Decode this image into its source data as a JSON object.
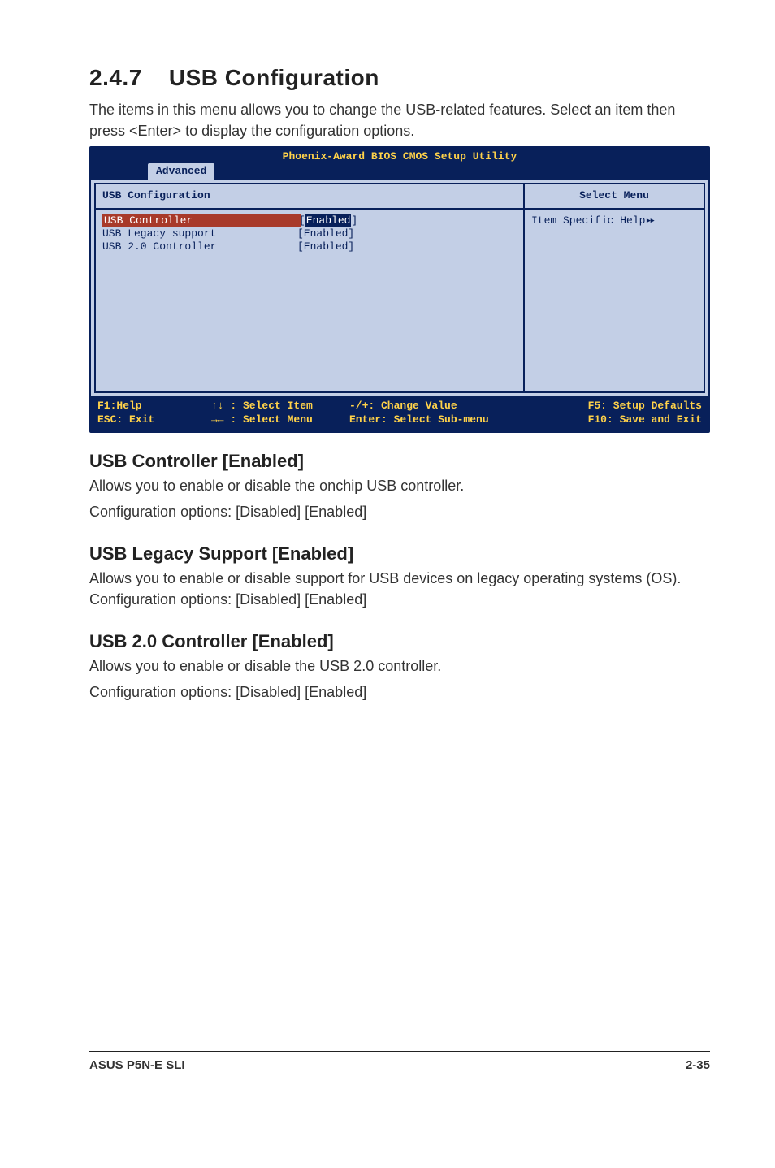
{
  "section": {
    "number": "2.4.7",
    "title": "USB Configuration",
    "intro": "The items in this menu allows you to change the USB-related features. Select an item then press <Enter> to display the configuration options."
  },
  "bios": {
    "utility_title": "Phoenix-Award BIOS CMOS Setup Utility",
    "active_tab": "Advanced",
    "panel_title": "USB Configuration",
    "side_title": "Select Menu",
    "side_help": "Item Specific Help",
    "rows": [
      {
        "label": "USB Controller",
        "value": "Enabled",
        "selected": true
      },
      {
        "label": "USB Legacy support",
        "value": "Enabled",
        "selected": false
      },
      {
        "label": "USB 2.0 Controller",
        "value": "Enabled",
        "selected": false
      }
    ],
    "footer": {
      "c1a": "F1:Help",
      "c1b": "ESC: Exit",
      "c2a": "↑↓ : Select Item",
      "c2b": "→← : Select Menu",
      "c3a": "-/+: Change Value",
      "c3b": "Enter: Select Sub-menu",
      "c4a": "F5: Setup Defaults",
      "c4b": "F10: Save and Exit"
    }
  },
  "subsections": [
    {
      "heading": "USB Controller [Enabled]",
      "lines": [
        "Allows you to enable or disable the onchip USB controller.",
        "Configuration options: [Disabled] [Enabled]"
      ]
    },
    {
      "heading": "USB Legacy Support [Enabled]",
      "lines": [
        "Allows you to enable or disable support for USB devices on legacy operating systems (OS). Configuration options: [Disabled] [Enabled]"
      ]
    },
    {
      "heading": "USB 2.0 Controller [Enabled]",
      "lines": [
        "Allows you to enable or disable the USB 2.0 controller.",
        "Configuration options: [Disabled] [Enabled]"
      ]
    }
  ],
  "footer": {
    "left": "ASUS P5N-E SLI",
    "right": "2-35"
  }
}
